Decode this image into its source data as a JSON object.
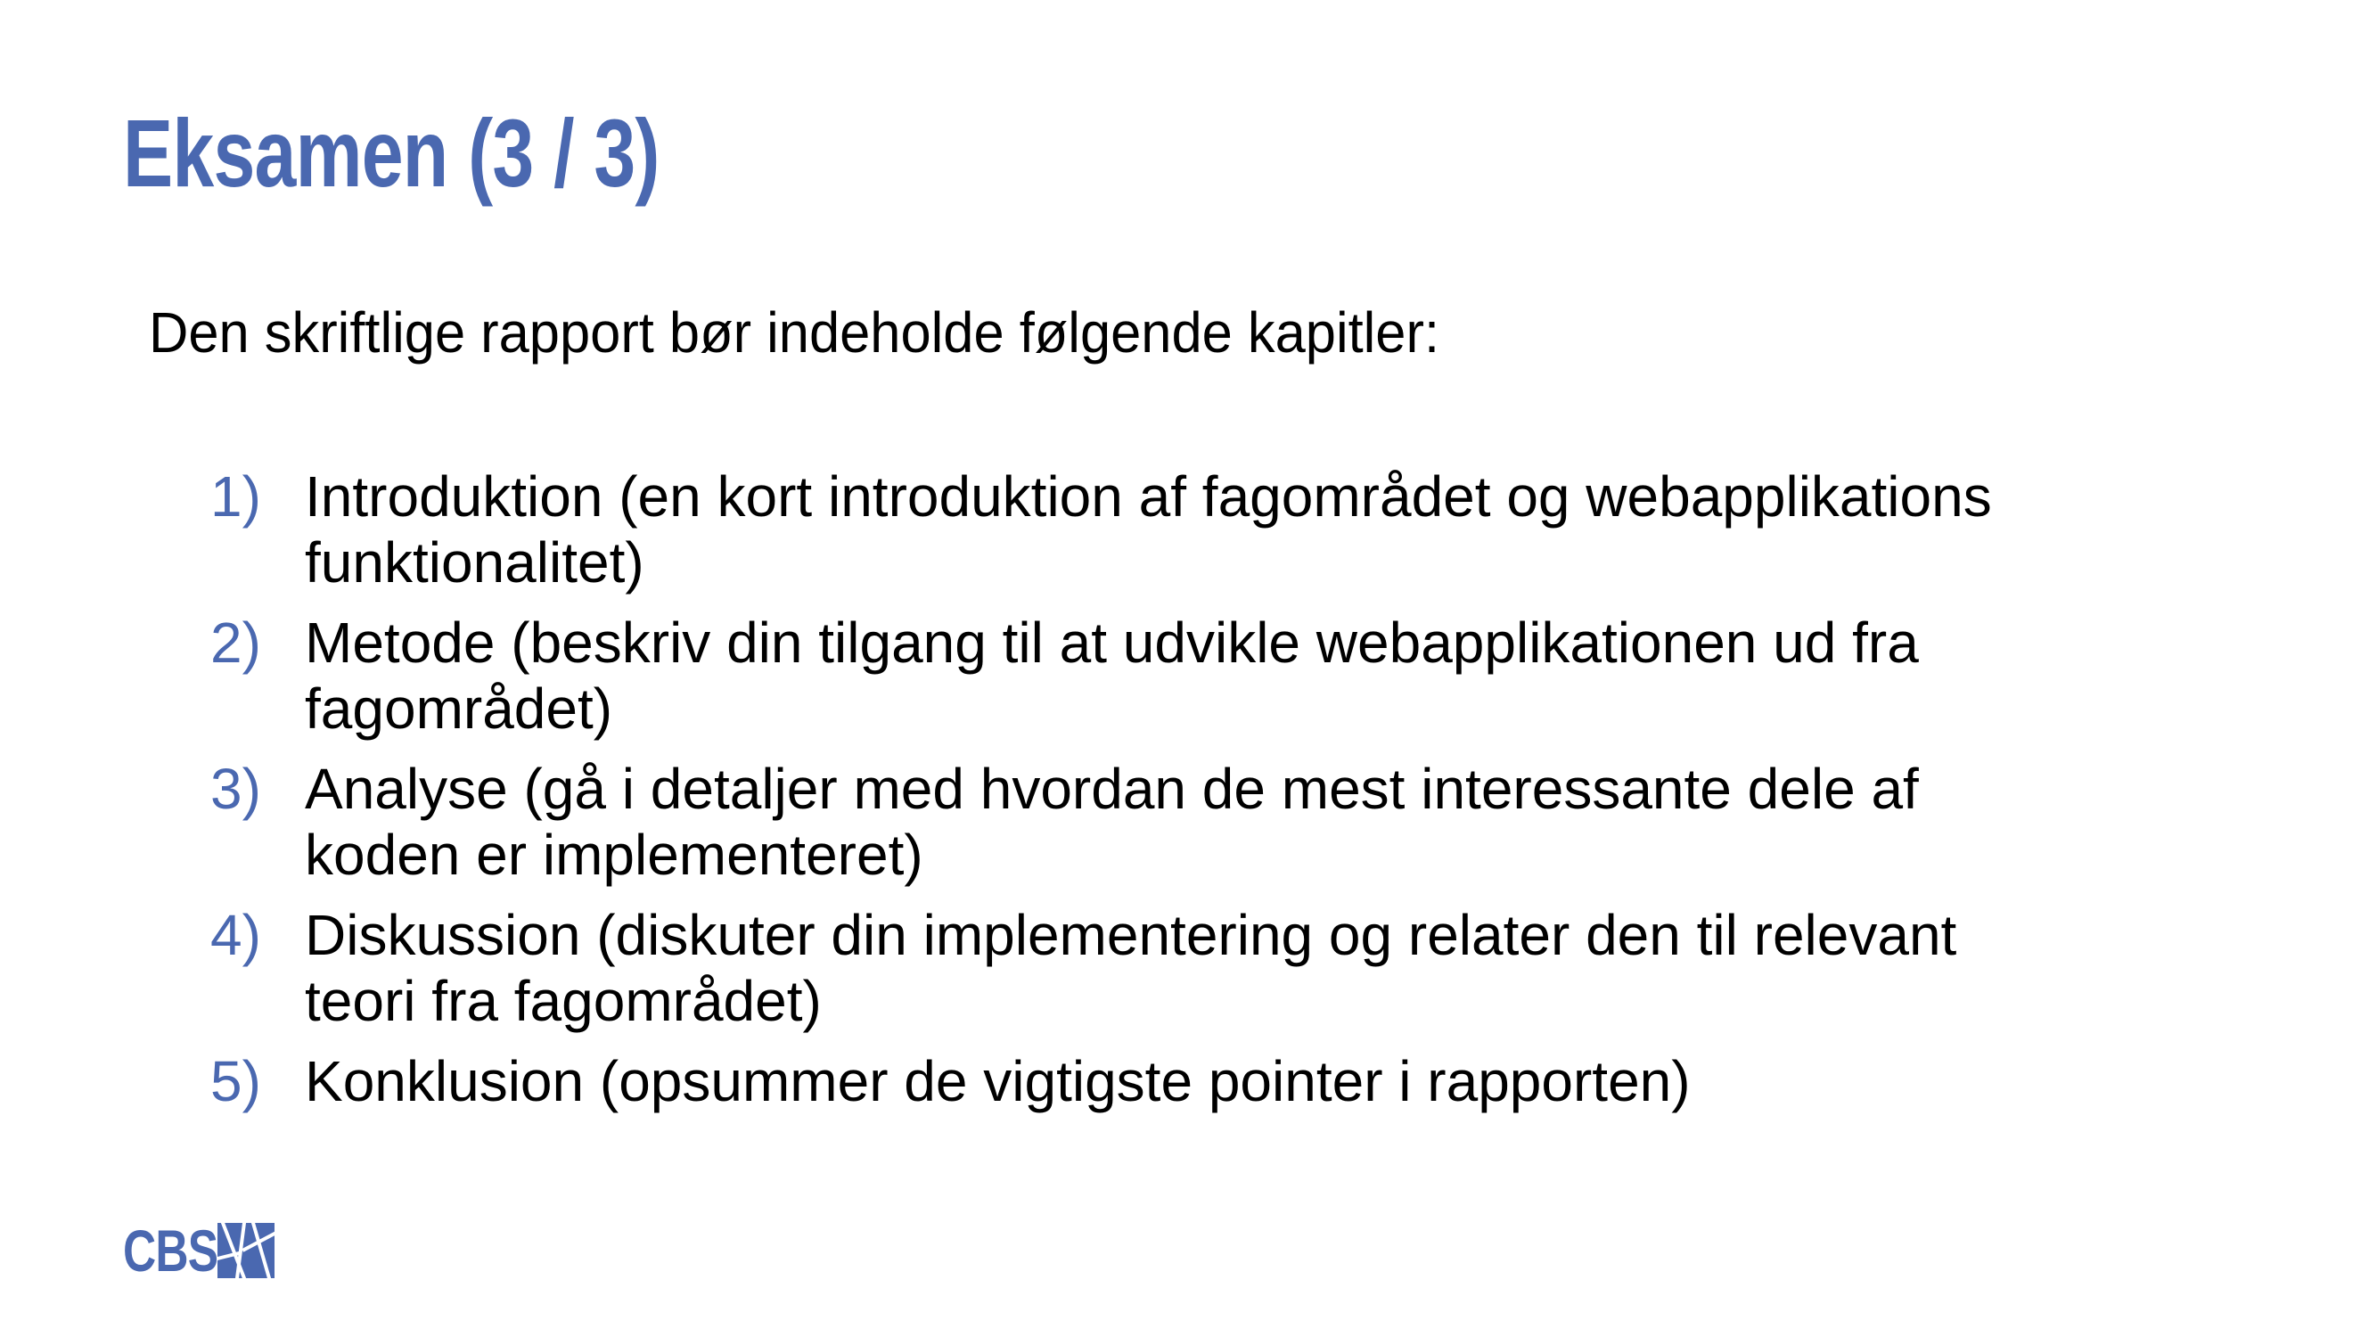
{
  "slide": {
    "title": "Eksamen (3 / 3)",
    "intro": "Den skriftlige rapport bør indeholde følgende kapitler:",
    "chapters": [
      {
        "number": "1)",
        "text": "Introduktion (en kort introduktion af fagområdet og webapplikations\nfunktionalitet)"
      },
      {
        "number": "2)",
        "text": "Metode (beskriv din tilgang til at udvikle webapplikationen ud fra\nfagområdet)"
      },
      {
        "number": "3)",
        "text": "Analyse (gå i detaljer med hvordan de mest interessante dele af\nkoden er implementeret)"
      },
      {
        "number": "4)",
        "text": "Diskussion (diskuter din implementering og relater den til relevant\nteori fra fagområdet)"
      },
      {
        "number": "5)",
        "text": "Konklusion (opsummer de vigtigste pointer i rapporten)"
      }
    ]
  },
  "footer": {
    "logo_text": "CBS",
    "logo_icon": "cbs-logo-icon"
  },
  "colors": {
    "accent": "#4a68b0",
    "text": "#000000",
    "background": "#ffffff"
  }
}
